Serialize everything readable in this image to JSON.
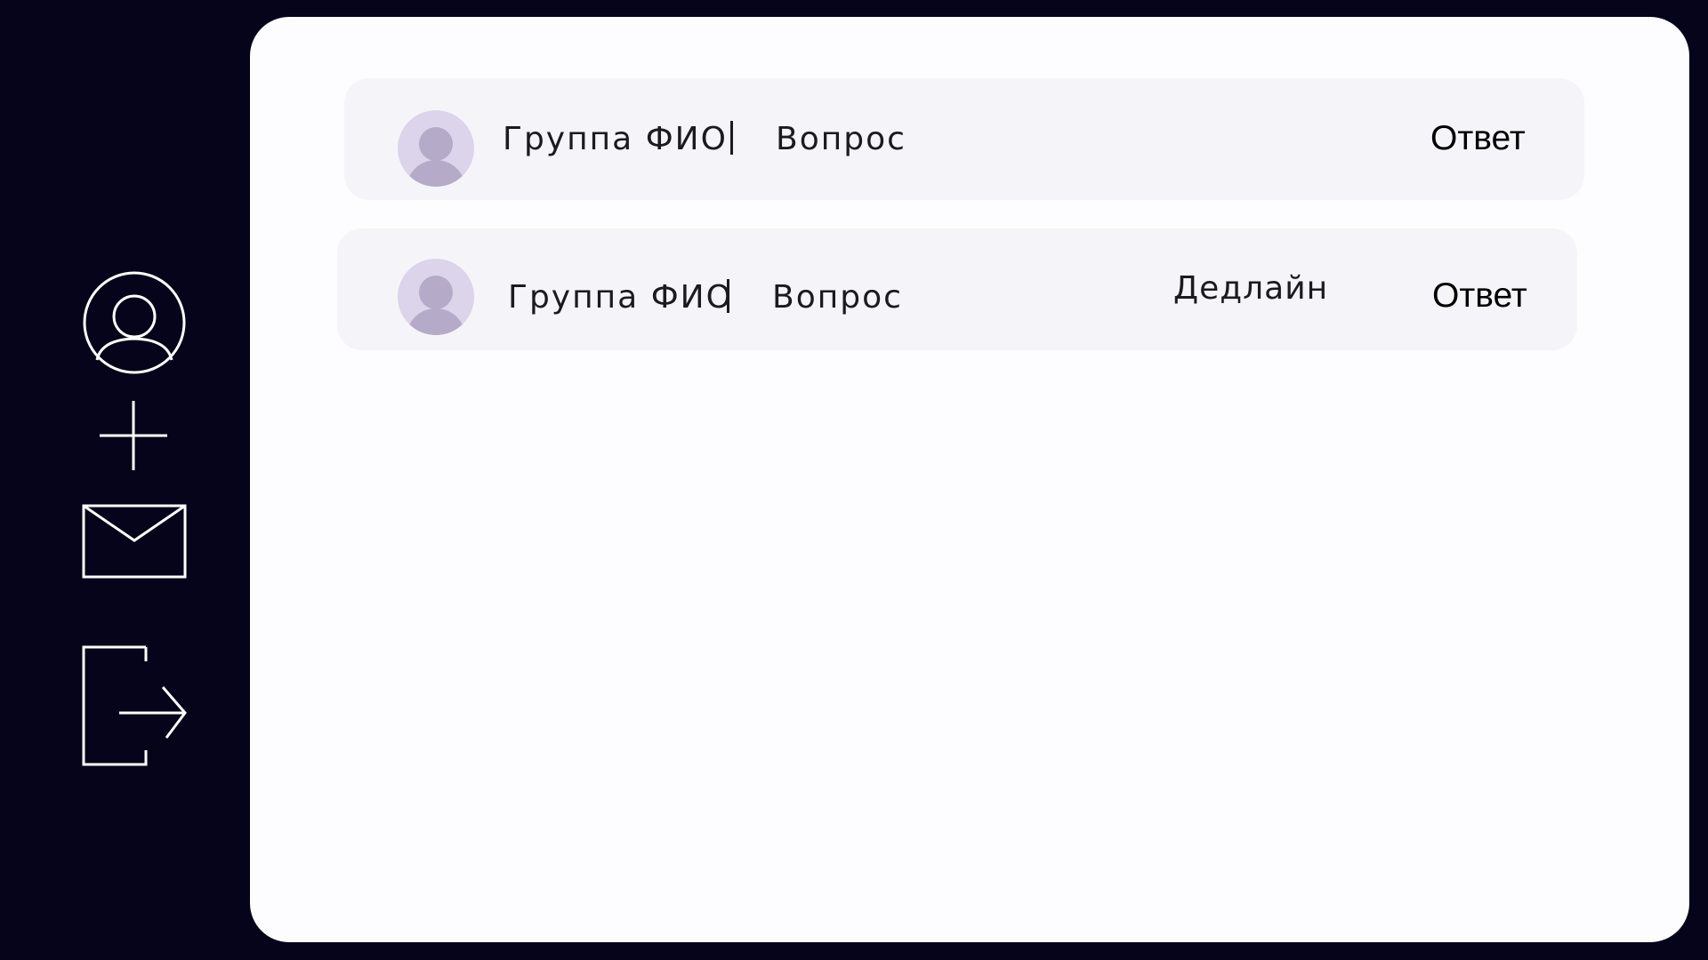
{
  "sidebar": {
    "items": [
      {
        "icon": "user-profile-icon"
      },
      {
        "icon": "plus-icon"
      },
      {
        "icon": "mail-icon"
      },
      {
        "icon": "logout-icon"
      }
    ]
  },
  "questions": [
    {
      "meta": "Группа ФИО",
      "question": "Вопрос",
      "deadline": "",
      "answer_label": "Ответ"
    },
    {
      "meta": "Группа ФИО",
      "question": "Вопрос",
      "deadline": "Дедлайн",
      "answer_label": "Ответ"
    }
  ],
  "colors": {
    "background": "#05041a",
    "panel": "#fdfdff",
    "card": "#f5f5f9",
    "avatar_bg": "#dcd4ea",
    "avatar_fg": "#b5abc8",
    "icon_stroke": "#ffffff"
  }
}
